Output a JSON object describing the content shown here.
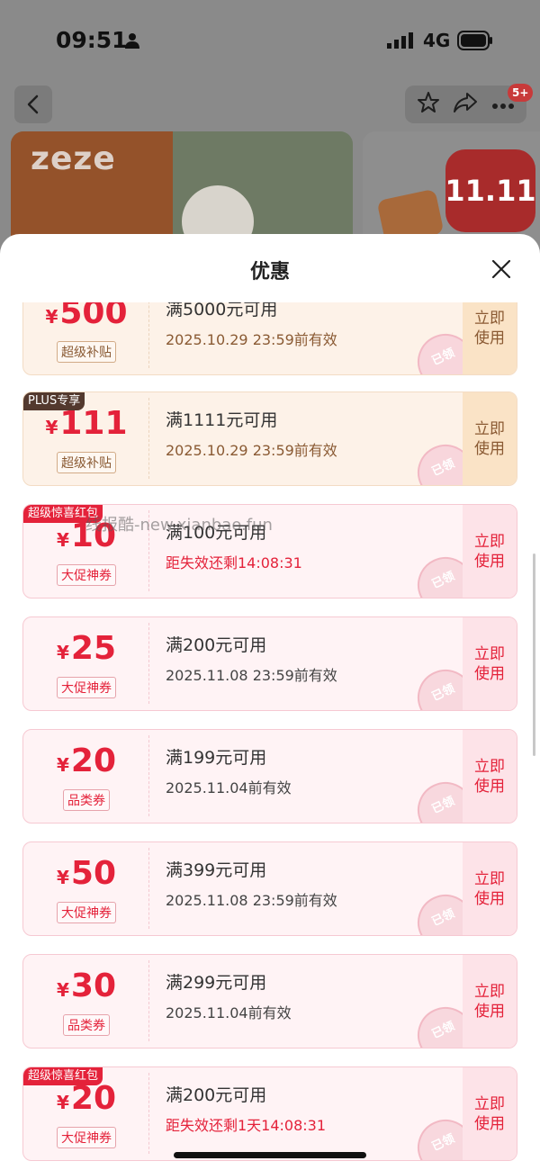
{
  "status_bar": {
    "time": "09:51",
    "network": "4G",
    "icons": [
      "person-icon",
      "signal-icon",
      "battery-icon"
    ]
  },
  "nav": {
    "notification_badge": "5+",
    "icons": [
      "back-icon",
      "star-icon",
      "share-icon",
      "more-icon"
    ]
  },
  "banner": {
    "brand": "zeze",
    "promo_logo": "11.11"
  },
  "sheet": {
    "title": "优惠",
    "close_icon": "close-icon"
  },
  "coupons": [
    {
      "style": "gold",
      "corner": "",
      "yen": "¥",
      "amount": "500",
      "tag": "超级补贴",
      "condition": "满5000元可用",
      "expiry": "2025.10.29 23:59前有效",
      "expiry_urgent": false,
      "button": "立即\n使用",
      "stamp": "已领"
    },
    {
      "style": "gold",
      "corner": "PLUS专享",
      "yen": "¥",
      "amount": "111",
      "tag": "超级补贴",
      "condition": "满1111元可用",
      "expiry": "2025.10.29 23:59前有效",
      "expiry_urgent": false,
      "button": "立即\n使用",
      "stamp": "已领"
    },
    {
      "style": "pink",
      "corner": "超级惊喜红包",
      "yen": "¥",
      "amount": "10",
      "tag": "大促神券",
      "condition": "满100元可用",
      "expiry": "距失效还剩14:08:31",
      "expiry_urgent": true,
      "button": "立即\n使用",
      "stamp": "已领"
    },
    {
      "style": "pink",
      "corner": "",
      "yen": "¥",
      "amount": "25",
      "tag": "大促神券",
      "condition": "满200元可用",
      "expiry": "2025.11.08 23:59前有效",
      "expiry_urgent": false,
      "button": "立即\n使用",
      "stamp": "已领"
    },
    {
      "style": "pink",
      "corner": "",
      "yen": "¥",
      "amount": "20",
      "tag": "品类券",
      "condition": "满199元可用",
      "expiry": "2025.11.04前有效",
      "expiry_urgent": false,
      "button": "立即\n使用",
      "stamp": "已领"
    },
    {
      "style": "pink",
      "corner": "",
      "yen": "¥",
      "amount": "50",
      "tag": "大促神券",
      "condition": "满399元可用",
      "expiry": "2025.11.08 23:59前有效",
      "expiry_urgent": false,
      "button": "立即\n使用",
      "stamp": "已领"
    },
    {
      "style": "pink",
      "corner": "",
      "yen": "¥",
      "amount": "30",
      "tag": "品类券",
      "condition": "满299元可用",
      "expiry": "2025.11.04前有效",
      "expiry_urgent": false,
      "button": "立即\n使用",
      "stamp": "已领"
    },
    {
      "style": "pink",
      "corner": "超级惊喜红包",
      "yen": "¥",
      "amount": "20",
      "tag": "大促神券",
      "condition": "满200元可用",
      "expiry": "距失效还剩1天14:08:31",
      "expiry_urgent": true,
      "button": "立即\n使用",
      "stamp": "已领"
    }
  ],
  "watermark": "线报酷-new.xianbao.fun",
  "colors": {
    "accent_red": "#e4223a",
    "gold_text": "#8a5a33",
    "pink_bg": "#fff3f5",
    "gold_bg": "#fdf2e8"
  }
}
